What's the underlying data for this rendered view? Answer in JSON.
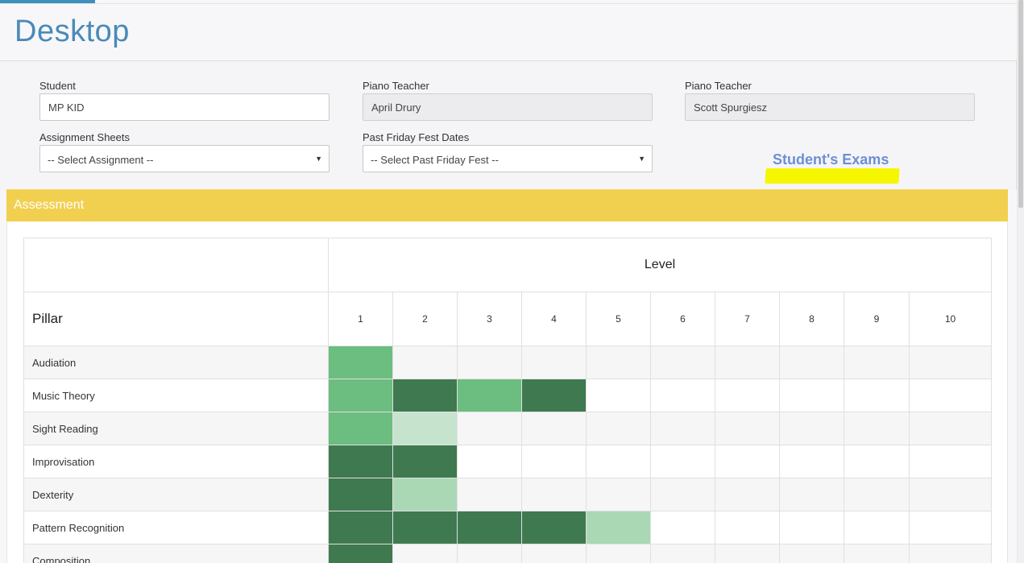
{
  "page": {
    "title": "Desktop"
  },
  "form": {
    "student": {
      "label": "Student",
      "value": "MP KID"
    },
    "teacher1": {
      "label": "Piano Teacher",
      "value": "April Drury"
    },
    "teacher2": {
      "label": "Piano Teacher",
      "value": "Scott Spurgiesz"
    },
    "assignment": {
      "label": "Assignment Sheets",
      "selected": "-- Select Assignment --"
    },
    "friday_fest": {
      "label": "Past Friday Fest Dates",
      "selected": "-- Select Past Friday Fest --"
    },
    "exams_link": "Student's Exams"
  },
  "assessment": {
    "title": "Assessment",
    "level_header": "Level",
    "pillar_header": "Pillar",
    "levels": [
      "1",
      "2",
      "3",
      "4",
      "5",
      "6",
      "7",
      "8",
      "9",
      "10"
    ],
    "rows": [
      {
        "pillar": "Audiation",
        "cells": [
          "mid",
          "",
          "",
          "",
          "",
          "",
          "",
          "",
          "",
          ""
        ]
      },
      {
        "pillar": "Music Theory",
        "cells": [
          "mid",
          "dark",
          "mid",
          "dark",
          "",
          "",
          "",
          "",
          "",
          ""
        ]
      },
      {
        "pillar": "Sight Reading",
        "cells": [
          "mid",
          "pale",
          "",
          "",
          "",
          "",
          "",
          "",
          "",
          ""
        ]
      },
      {
        "pillar": "Improvisation",
        "cells": [
          "dark",
          "dark",
          "",
          "",
          "",
          "",
          "",
          "",
          "",
          ""
        ]
      },
      {
        "pillar": "Dexterity",
        "cells": [
          "dark",
          "light",
          "",
          "",
          "",
          "",
          "",
          "",
          "",
          ""
        ]
      },
      {
        "pillar": "Pattern Recognition",
        "cells": [
          "dark",
          "dark",
          "dark",
          "dark",
          "light",
          "",
          "",
          "",
          "",
          ""
        ]
      },
      {
        "pillar": "Composition",
        "cells": [
          "dark",
          "",
          "",
          "",
          "",
          "",
          "",
          "",
          "",
          ""
        ]
      }
    ]
  },
  "colors": {
    "title_blue": "#4a8ab8",
    "assessment_yellow": "#f2d04f",
    "level_dark": "#3f7950",
    "level_mid": "#6cbd80",
    "level_light": "#aad8b5",
    "level_pale": "#c6e4cd",
    "highlight": "#f6f600",
    "link_blue": "#6c8fd6"
  }
}
